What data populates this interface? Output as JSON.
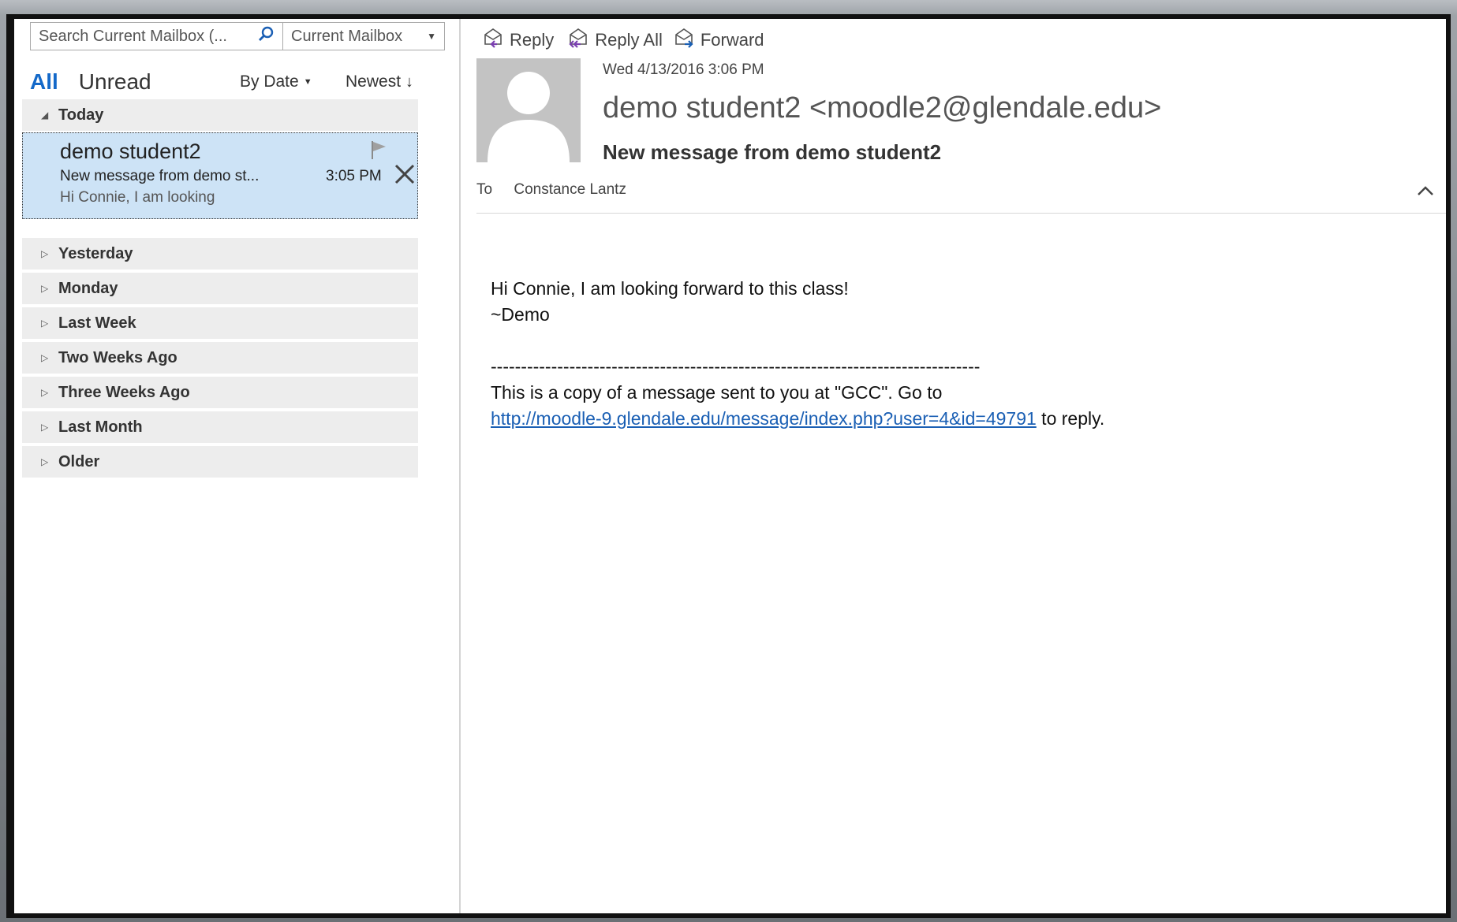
{
  "search": {
    "placeholder": "Search Current Mailbox (...",
    "scope": "Current Mailbox"
  },
  "filters": {
    "all": "All",
    "unread": "Unread",
    "sort_by": "By Date",
    "sort_order": "Newest"
  },
  "groups": {
    "today": "Today",
    "yesterday": "Yesterday",
    "monday": "Monday",
    "last_week": "Last Week",
    "two_weeks": "Two Weeks Ago",
    "three_weeks": "Three Weeks Ago",
    "last_month": "Last Month",
    "older": "Older"
  },
  "selected_mail": {
    "sender": "demo student2",
    "subject": "New message from demo st...",
    "preview": "Hi Connie, I am looking",
    "time": "3:05 PM"
  },
  "toolbar": {
    "reply": "Reply",
    "reply_all": "Reply All",
    "forward": "Forward"
  },
  "message": {
    "date": "Wed 4/13/2016 3:06 PM",
    "from": "demo student2 <moodle2@glendale.edu>",
    "subject": "New message from demo student2",
    "to_label": "To",
    "to": "Constance Lantz",
    "body_line1": "Hi Connie, I am looking forward to this class!",
    "body_line2": "~Demo",
    "separator": "---------------------------------------------------------------------------------",
    "copy_note": "This is a copy of a message sent to you at \"GCC\". Go to",
    "link": "http://moodle-9.glendale.edu/message/index.php?user=4&id=49791",
    "link_suffix": " to reply."
  },
  "colors": {
    "accent": "#1469c9",
    "selected_bg": "#cde3f6",
    "group_bg": "#ededed",
    "link": "#1a5fb4"
  }
}
